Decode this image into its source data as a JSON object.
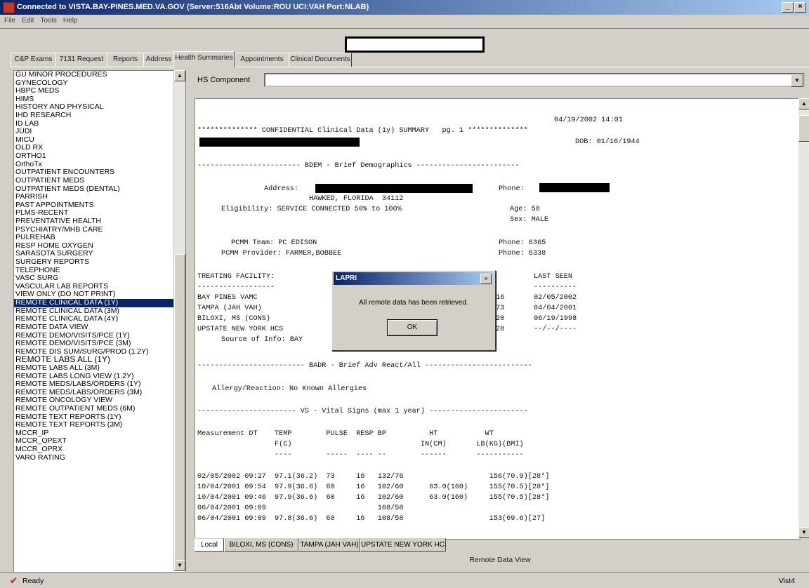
{
  "window": {
    "title": "Connected to VISTA.BAY-PINES.MED.VA.GOV (Server:516Abt Volume:ROU UCI:VAH Port:NLAB)",
    "minimize": "_",
    "close": "×"
  },
  "menu": [
    "File",
    "Edit",
    "Tools",
    "Help"
  ],
  "tabs": [
    "C&P Exams",
    "7131 Request",
    "Reports",
    "Address",
    "Health Summaries",
    "Appointments",
    "Clinical Documents"
  ],
  "active_tab": "Health Summaries",
  "left_list": {
    "items": [
      "GU MINOR PROCEDURES",
      "GYNECOLOGY",
      "HBPC MEDS",
      "HIMS",
      "HISTORY AND PHYSICAL",
      "IHD RESEARCH",
      "ID LAB",
      "JUDI",
      "MICU",
      "OLD RX",
      "ORTHO1",
      "OrthoTx",
      "OUTPATIENT ENCOUNTERS",
      "OUTPATIENT MEDS",
      "OUTPATIENT MEDS (DENTAL)",
      "PARRISH",
      "PAST APPOINTMENTS",
      "PLMS-RECENT",
      "PREVENTATIVE HEALTH",
      "PSYCHIATRY/MHB CARE",
      "PULREHAB",
      "RESP HOME OXYGEN",
      "SARASOTA SURGERY",
      "SURGERY REPORTS",
      "TELEPHONE",
      "VASC SURG",
      "VASCULAR LAB REPORTS",
      "VIEW ONLY (DO NOT PRINT)",
      "REMOTE CLINICAL DATA (1Y)",
      "REMOTE CLINICAL DATA (3M)",
      "REMOTE CLINICAL DATA (4Y)",
      "REMOTE DATA VIEW",
      "REMOTE DEMO/VISITS/PCE (1Y)",
      "REMOTE DEMO/VISITS/PCE (3M)",
      "REMOTE DIS SUM/SURG/PROD (1.2Y)",
      "REMOTE LABS ALL (1Y)",
      "REMOTE LABS ALL (3M)",
      "REMOTE LABS LONG VIEW (1.2Y)",
      "REMOTE MEDS/LABS/ORDERS (1Y)",
      "REMOTE MEDS/LABS/ORDERS (3M)",
      "REMOTE ONCOLOGY VIEW",
      "REMOTE OUTPATIENT MEDS (6M)",
      "REMOTE TEXT REPORTS (1Y)",
      "REMOTE TEXT REPORTS (3M)",
      "MCCR_IP",
      "MCCR_OPEXT",
      "MCCR_OPRX",
      "VARO RATING"
    ],
    "selected": "REMOTE CLINICAL DATA (1Y)"
  },
  "hs_component": {
    "label": "HS Component",
    "value": ""
  },
  "report": {
    "datetime": "04/19/2002 14:01",
    "header": "************** CONFIDENTIAL Clinical Data (1y) SUMMARY   pg. 1 **************",
    "dob": "DOB: 01/16/1944",
    "bdem_header": "------------------------ BDEM - Brief Demographics ------------------------",
    "address_label": "Address:",
    "city": "HAWKED, FLORIDA  34112",
    "phone_label": "Phone:",
    "eligibility": "Eligibility: SERVICE CONNECTED 50% to 100%",
    "age": "Age: 58",
    "sex": "Sex: MALE",
    "pcmm_team": "PCMM Team: PC EDISON",
    "pcmm_provider": "PCMM Provider: FARMER,BOBBEE",
    "phone1": "Phone: 6365",
    "phone2": "Phone: 6338",
    "treating_header": "TREATING FACILITY:",
    "last_seen_header": "LAST SEEN",
    "facilities": [
      "BAY PINES VAMC",
      "TAMPA (JAH VAH)",
      "BILOXI, MS (CONS)",
      "UPSTATE NEW YORK HCS"
    ],
    "fac_codes": [
      "16",
      "73",
      "20",
      "28"
    ],
    "last_seen": [
      "02/05/2002",
      "04/04/2001",
      "06/19/1998",
      "--/--/----"
    ],
    "source": "Source of Info: BAY",
    "badr_header": "------------------------- BADR - Brief Adv React/All -------------------------",
    "allergy": "Allergy/Reaction: No Known Allergies",
    "vs_header": "----------------------- VS - Vital Signs (max 1 year) -----------------------",
    "vs_cols1": "Measurement DT    TEMP        PULSE  RESP BP          HT           WT",
    "vs_cols2": "                  F(C)                              IN(CM)       LB(KG)(BMI)",
    "vs_cols3": "                  ----        -----  ---- --        ------       -----------",
    "vs_rows": [
      "02/05/2002 09:27  97.1(36.2)  73     16   132/76                    156(70.9)[28*]",
      "10/04/2001 09:54  97.9(36.6)  60     16   102/60      63.0(160)     155(70.5)[28*]",
      "10/04/2001 09:46  97.9(36.6)  60     16   102/60      63.0(160)     155(70.5)[28*]",
      "06/04/2001 09:09                          108/58",
      "06/04/2001 09:09  97.8(36.6)  68     16   108/58                    153(69.6)[27]"
    ]
  },
  "bottom_tabs": [
    "Local",
    "BILOXI, MS (CONS)",
    "TAMPA (JAH VAH)",
    "UPSTATE NEW YORK HCS"
  ],
  "bottom_caption": "Remote Data View",
  "dialog": {
    "title": "LAPRI",
    "message": "All remote data has been retrieved.",
    "ok": "OK",
    "close": "×"
  },
  "status": {
    "text": "Ready",
    "right": "Vist4"
  }
}
